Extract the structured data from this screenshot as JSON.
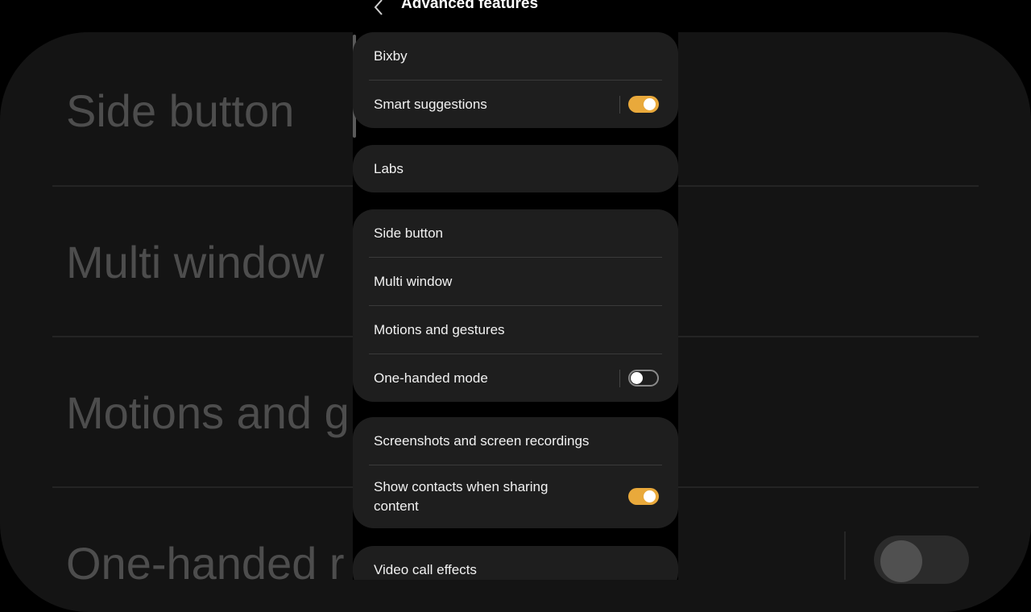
{
  "background": {
    "rows": [
      "Side button",
      "Multi window",
      "Motions and g",
      "One-handed r"
    ]
  },
  "header": {
    "title": "Advanced features",
    "back_icon": "chevron-left-icon"
  },
  "groups": [
    {
      "items": [
        {
          "label": "Bixby"
        },
        {
          "label": "Smart suggestions",
          "toggle": true,
          "on": true
        }
      ]
    },
    {
      "items": [
        {
          "label": "Labs"
        }
      ]
    },
    {
      "items": [
        {
          "label": "Side button"
        },
        {
          "label": "Multi window"
        },
        {
          "label": "Motions and gestures"
        },
        {
          "label": "One-handed mode",
          "toggle": true,
          "on": false
        }
      ]
    },
    {
      "items": [
        {
          "label": "Screenshots and screen recordings"
        },
        {
          "label": "Show contacts when sharing content",
          "toggle": true,
          "on": true
        }
      ]
    },
    {
      "items": [
        {
          "label": "Video call effects"
        }
      ]
    }
  ],
  "colors": {
    "toggle_on": "#e9a93b",
    "card": "#1e1e1e"
  }
}
